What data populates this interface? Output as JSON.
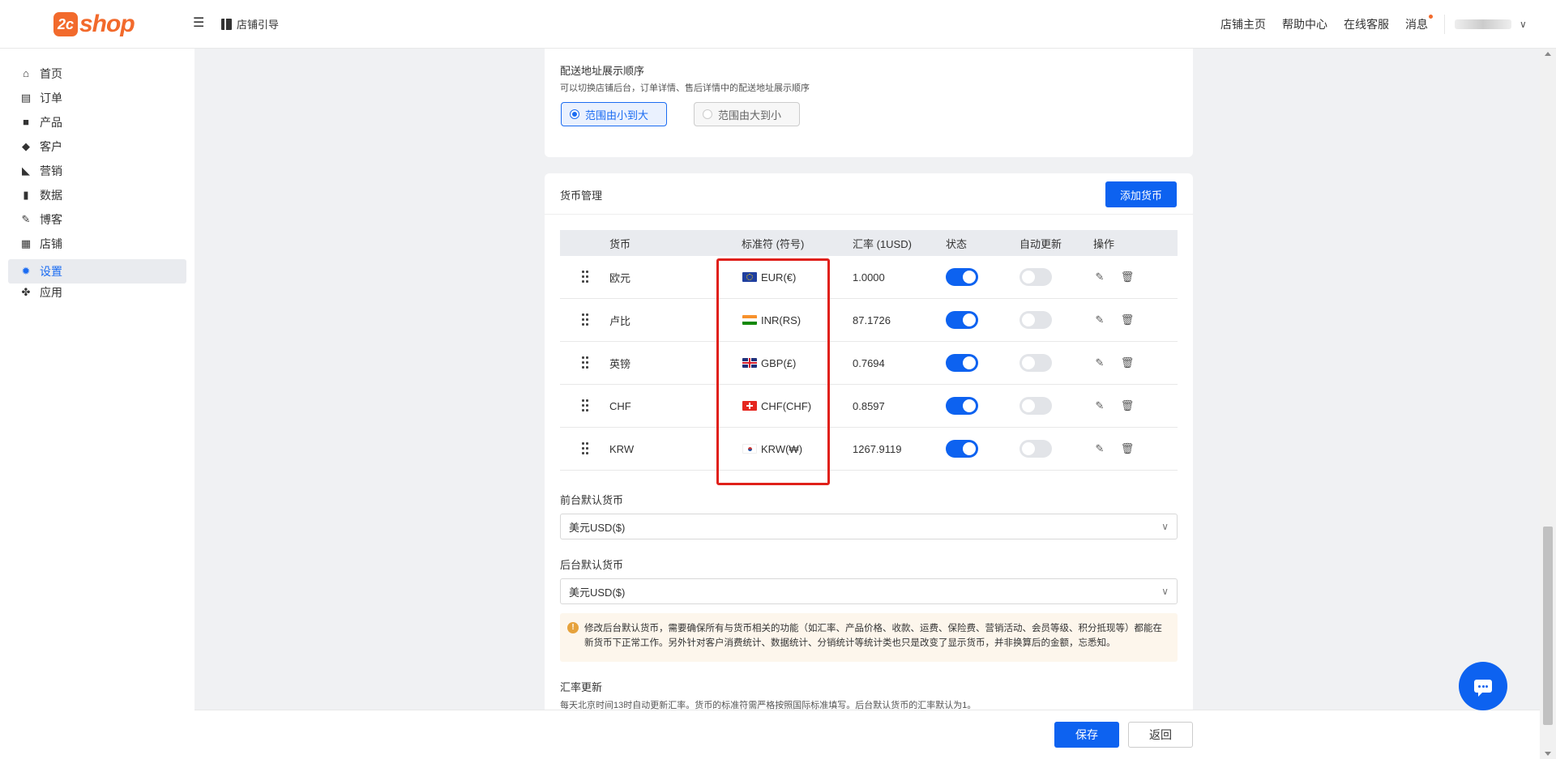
{
  "header": {
    "logo_badge": "2c",
    "logo_text": "shop",
    "guide": "店铺引导",
    "links": [
      "店铺主页",
      "帮助中心",
      "在线客服",
      "消息"
    ]
  },
  "sidebar": {
    "items": [
      {
        "label": "首页",
        "icon": "home-icon",
        "glyph": "⌂"
      },
      {
        "label": "订单",
        "icon": "clipboard-icon",
        "glyph": "▤"
      },
      {
        "label": "产品",
        "icon": "bag-icon",
        "glyph": "■"
      },
      {
        "label": "客户",
        "icon": "diamond-icon",
        "glyph": "◆"
      },
      {
        "label": "营销",
        "icon": "tag-icon",
        "glyph": "◣"
      },
      {
        "label": "数据",
        "icon": "bar-chart-icon",
        "glyph": "▮"
      },
      {
        "label": "博客",
        "icon": "edit-icon",
        "glyph": "✎"
      },
      {
        "label": "店铺",
        "icon": "store-icon",
        "glyph": "▦"
      },
      {
        "label": "设置",
        "icon": "gear-icon",
        "glyph": "✹"
      },
      {
        "label": "应用",
        "icon": "puzzle-icon",
        "glyph": "✤"
      }
    ],
    "active_index": 8
  },
  "address_order": {
    "title": "配送地址展示顺序",
    "subtitle": "可以切换店铺后台，订单详情、售后详情中的配送地址展示顺序",
    "option_small_to_large": "范围由小到大",
    "option_large_to_small": "范围由大到小",
    "selected": "范围由小到大"
  },
  "currency": {
    "title": "货币管理",
    "add_button": "添加货币",
    "columns": [
      "货币",
      "标准符 (符号)",
      "汇率 (1USD)",
      "状态",
      "自动更新",
      "操作"
    ],
    "rows": [
      {
        "name": "欧元",
        "code": "EUR(€)",
        "flag": "eu",
        "rate": "1.0000",
        "enabled": true,
        "auto_update": false
      },
      {
        "name": "卢比",
        "code": "INR(RS)",
        "flag": "in",
        "rate": "87.1726",
        "enabled": true,
        "auto_update": false
      },
      {
        "name": "英镑",
        "code": "GBP(£)",
        "flag": "gb",
        "rate": "0.7694",
        "enabled": true,
        "auto_update": false
      },
      {
        "name": "CHF",
        "code": "CHF(CHF)",
        "flag": "ch",
        "rate": "0.8597",
        "enabled": true,
        "auto_update": false
      },
      {
        "name": "KRW",
        "code": "KRW(₩)",
        "flag": "kr",
        "rate": "1267.9119",
        "enabled": true,
        "auto_update": false
      }
    ],
    "frontend_default_label": "前台默认货币",
    "frontend_default_value": "美元USD($)",
    "backend_default_label": "后台默认货币",
    "backend_default_value": "美元USD($)",
    "warning": "修改后台默认货币，需要确保所有与货币相关的功能（如汇率、产品价格、收款、运费、保险费、营销活动、会员等级、积分抵现等）都能在新货币下正常工作。另外针对客户消费统计、数据统计、分销统计等统计类也只是改变了显示货币，并非换算后的金额，忘悉知。",
    "rate_update_title": "汇率更新",
    "rate_update_desc": "每天北京时间13时自动更新汇率。货币的标准符需严格按照国际标准填写。后台默认货币的汇率默认为1。"
  },
  "footer": {
    "save": "保存",
    "back": "返回"
  },
  "colors": {
    "brand": "#f26a2c",
    "primary": "#0d62f0",
    "highlight": "#e0201a"
  }
}
